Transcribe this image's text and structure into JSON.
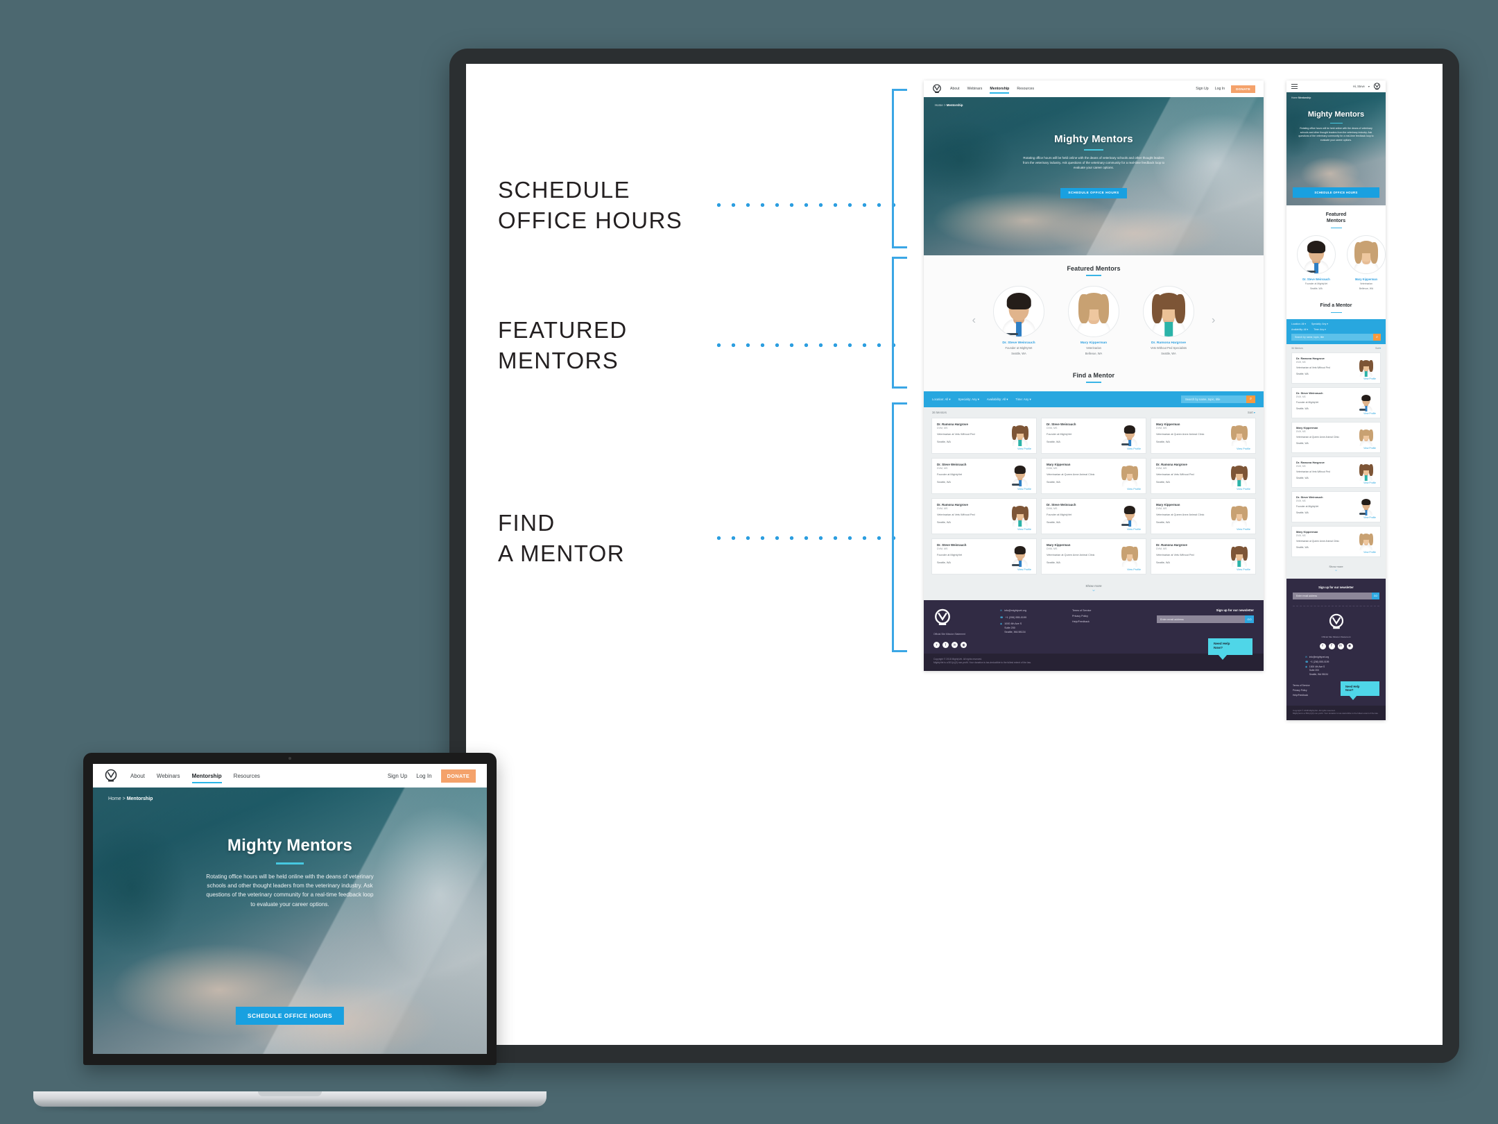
{
  "annotations": [
    {
      "label": "SCHEDULE\nOFFICE HOURS"
    },
    {
      "label": "FEATURED\nMENTORS"
    },
    {
      "label": "FIND\nA MENTOR"
    }
  ],
  "site": {
    "brand": "mightyvet",
    "nav": {
      "links": [
        "About",
        "Webinars",
        "Mentorship",
        "Resources"
      ],
      "active": "Mentorship",
      "sign_up": "Sign Up",
      "log_in": "Log In",
      "donate": "DONATE",
      "mobile_user": "Hi, Steve"
    },
    "breadcrumb": {
      "home": "Home",
      "separator": ">",
      "current": "Mentorship"
    },
    "hero": {
      "title": "Mighty Mentors",
      "body": "Rotating office hours will be held online with the deans of veterinary schools and other thought leaders from the veterinary industry. Ask questions of the veterinary community for a real-time feedback loop to evaluate your career options.",
      "cta": "SCHEDULE OFFICE HOURS"
    },
    "featured": {
      "title": "Featured Mentors",
      "title_mobile": "Featured\nMentors",
      "prev": "‹",
      "next": "›",
      "mentors": [
        {
          "name": "Dr. Steve Weinrauch",
          "role": "Founder at MightyVet",
          "location": "Seattle, WA"
        },
        {
          "name": "Mary Kipperman",
          "role": "Veterinarian",
          "location": "Bellevue, WA"
        },
        {
          "name": "Dr. Ramona Hargrove",
          "role": "Vets Without Ped Specialists",
          "location": "Seattle, WA"
        }
      ]
    },
    "find": {
      "title": "Find a Mentor",
      "filters": [
        "Location: All ▾",
        "Specialty: Any ▾",
        "Availability: All ▾",
        "Time: Any ▾"
      ],
      "search_placeholder": "Search by name, topic, title",
      "search_icon": "⌕",
      "results_count": "36 Mentors",
      "sort_label": "Sort",
      "sort_caret": "▾",
      "show_more": "Show more",
      "show_more_chevron": "⌄",
      "view_profile": "View Profile",
      "cards": [
        {
          "name": "Dr. Ramona Hargrove",
          "credentials": "DVM, MS",
          "role": "Veterinarian at Vets Without Ped",
          "location": "Seattle, WA"
        },
        {
          "name": "Dr. Steve Weinrauch",
          "credentials": "DVM, MS",
          "role": "Founder at MightyVet",
          "location": "Seattle, WA"
        },
        {
          "name": "Mary Kipperman",
          "credentials": "DVM, MS",
          "role": "Veterinarian at Queen Anne Animal Clinic",
          "location": "Seattle, WA"
        },
        {
          "name": "Dr. Steve Weinrauch",
          "credentials": "DVM, MS",
          "role": "Founder at MightyVet",
          "location": "Seattle, WA"
        },
        {
          "name": "Mary Kipperman",
          "credentials": "DVM, MS",
          "role": "Veterinarian at Queen Anne Animal Clinic",
          "location": "Seattle, WA"
        },
        {
          "name": "Dr. Ramona Hargrove",
          "credentials": "DVM, MS",
          "role": "Veterinarian at Vets Without Ped",
          "location": "Seattle, WA"
        },
        {
          "name": "Dr. Ramona Hargrove",
          "credentials": "DVM, MS",
          "role": "Veterinarian at Vets Without Ped",
          "location": "Seattle, WA"
        },
        {
          "name": "Dr. Steve Weinrauch",
          "credentials": "DVM, MS",
          "role": "Founder at MightyVet",
          "location": "Seattle, WA"
        },
        {
          "name": "Mary Kipperman",
          "credentials": "DVM, MS",
          "role": "Veterinarian at Queen Anne Animal Clinic",
          "location": "Seattle, WA"
        },
        {
          "name": "Dr. Steve Weinrauch",
          "credentials": "DVM, MS",
          "role": "Founder at MightyVet",
          "location": "Seattle, WA"
        },
        {
          "name": "Mary Kipperman",
          "credentials": "DVM, MS",
          "role": "Veterinarian at Queen Anne Animal Clinic",
          "location": "Seattle, WA"
        },
        {
          "name": "Dr. Ramona Hargrove",
          "credentials": "DVM, MS",
          "role": "Veterinarian at Vets Without Ped",
          "location": "Seattle, WA"
        }
      ],
      "mobile_cards": [
        {
          "name": "Dr. Ramona Hargrove",
          "credentials": "DVM, MS",
          "role": "Veterinarian at Vets Without Ped",
          "location": "Seattle, WA"
        },
        {
          "name": "Dr. Steve Weinrauch",
          "credentials": "DVM, MS",
          "role": "Founder at MightyVet",
          "location": "Seattle, WA"
        },
        {
          "name": "Mary Kipperman",
          "credentials": "DVM, MS",
          "role": "Veterinarian at Queen Anne Animal Clinic",
          "location": "Seattle, WA"
        },
        {
          "name": "Dr. Ramona Hargrove",
          "credentials": "DVM, MS",
          "role": "Veterinarian at Vets Without Ped",
          "location": "Seattle, WA"
        },
        {
          "name": "Dr. Steve Weinrauch",
          "credentials": "DVM, MS",
          "role": "Founder at MightyVet",
          "location": "Seattle, WA"
        },
        {
          "name": "Mary Kipperman",
          "credentials": "DVM, MS",
          "role": "Veterinarian at Queen Anne Animal Clinic",
          "location": "Seattle, WA"
        }
      ]
    },
    "footer": {
      "tagline": "Official Site Mission Statement",
      "social": [
        "ᴛ",
        "f",
        "in",
        "◉"
      ],
      "contact": [
        {
          "icon": "✉",
          "text": "info@mightyvet.org"
        },
        {
          "icon": "☎",
          "text": "+1 (206) 555-0199"
        },
        {
          "icon": "◉",
          "text": "1000 4th Ave S\nSuite 200\nSeattle, WA 98134"
        }
      ],
      "links": [
        "Terms of Service",
        "Privacy Policy",
        "Help/Feedback"
      ],
      "newsletter_title": "Sign up for our newsletter",
      "newsletter_placeholder": "Enter email address",
      "newsletter_button": "GO",
      "need_help": "Need Help\nNow?",
      "copyright": "Copyright © 2018 MightyVet. All rights reserved.\nMightyVet is a 501(c)(3) non-profit. Your donation is tax-deductible to the fullest extent of the law."
    }
  },
  "colors": {
    "accent_blue": "#19a0e0",
    "filter_blue": "#28a7df",
    "teal": "#46c8e0",
    "orange": "#f4a26b",
    "search_orange": "#f79a3e",
    "footer_purple": "#312b44",
    "background": "#4c6870",
    "annotation_dot": "#2e9fe0"
  }
}
